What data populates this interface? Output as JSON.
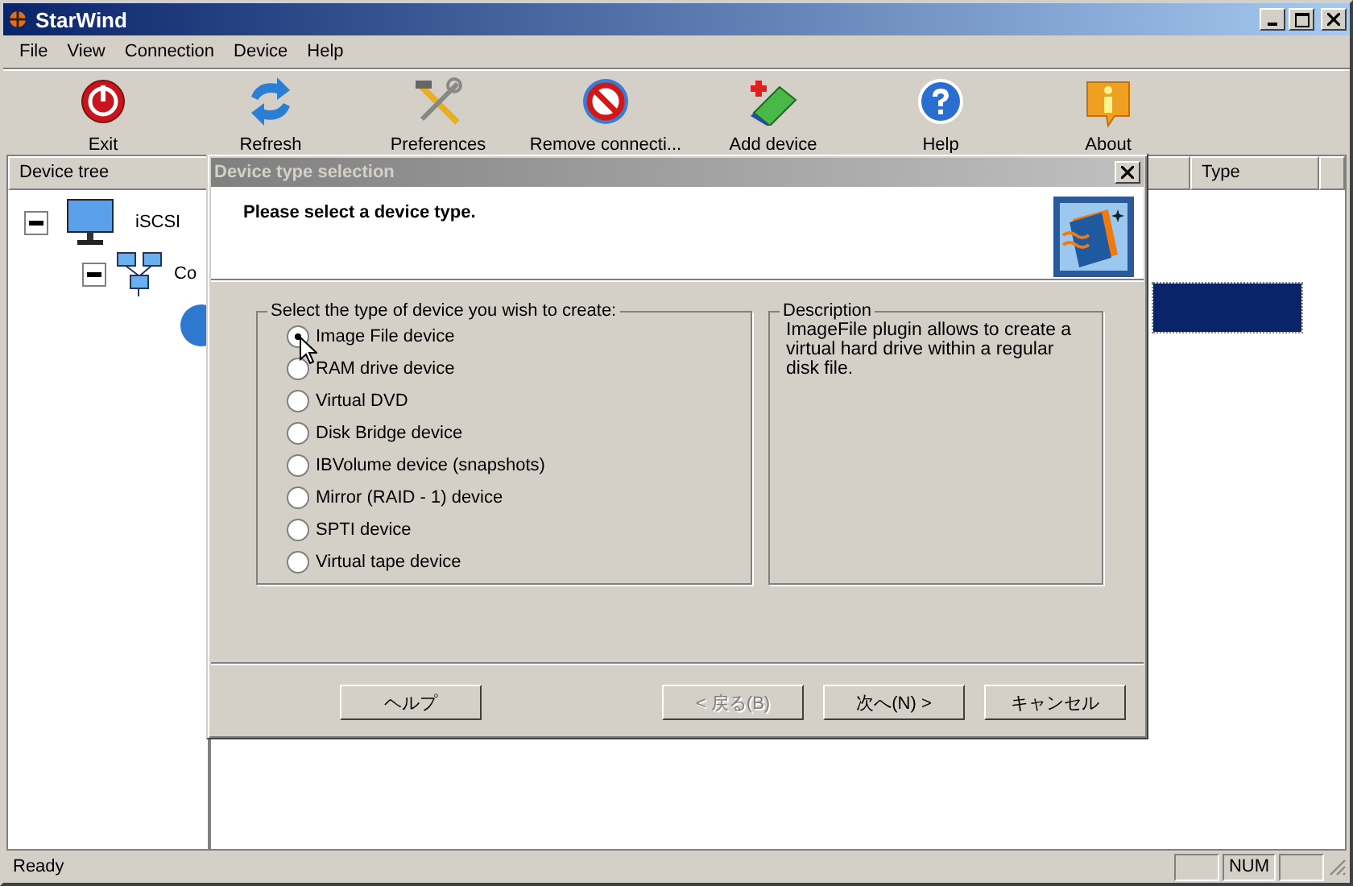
{
  "window": {
    "title": "StarWind"
  },
  "menu": [
    "File",
    "View",
    "Connection",
    "Device",
    "Help"
  ],
  "toolbar": [
    {
      "label": "Exit",
      "kind": "exit"
    },
    {
      "label": "Refresh",
      "kind": "refresh"
    },
    {
      "label": "Preferences",
      "kind": "tools"
    },
    {
      "label": "Remove connecti...",
      "kind": "remove"
    },
    {
      "label": "Add device",
      "kind": "add"
    },
    {
      "label": "Help",
      "kind": "help"
    },
    {
      "label": "About",
      "kind": "about"
    }
  ],
  "tree": {
    "header": "Device tree",
    "items": [
      {
        "label": "iSCSI",
        "expanded": true,
        "children": [
          {
            "label": "Co",
            "expanded": true
          }
        ]
      }
    ]
  },
  "list": {
    "columns": [
      "",
      "Type",
      ""
    ],
    "rows": [
      {
        "selected": true
      }
    ]
  },
  "dialog": {
    "title": "Device type selection",
    "heading": "Please select a device type.",
    "group_title": "Select the type of device you wish to create:",
    "options": [
      {
        "label": "Image File device",
        "selected": true
      },
      {
        "label": "RAM drive device",
        "selected": false
      },
      {
        "label": "Virtual DVD",
        "selected": false
      },
      {
        "label": "Disk Bridge device",
        "selected": false
      },
      {
        "label": "IBVolume device (snapshots)",
        "selected": false
      },
      {
        "label": "Mirror (RAID - 1) device",
        "selected": false
      },
      {
        "label": "SPTI device",
        "selected": false
      },
      {
        "label": "Virtual tape device",
        "selected": false
      }
    ],
    "description_title": "Description",
    "description": "ImageFile plugin allows to create a virtual hard drive within a regular disk file.",
    "buttons": [
      {
        "label": "ヘルプ",
        "disabled": false
      },
      {
        "label": "< 戻る(B)",
        "disabled": true
      },
      {
        "label": "次へ(N) >",
        "disabled": false
      },
      {
        "label": "キャンセル",
        "disabled": false
      }
    ]
  },
  "status_bar": {
    "text": "Ready",
    "panels": [
      {
        "kind": "blank"
      },
      {
        "kind": "text",
        "text": "NUM"
      },
      {
        "kind": "blank"
      }
    ]
  }
}
